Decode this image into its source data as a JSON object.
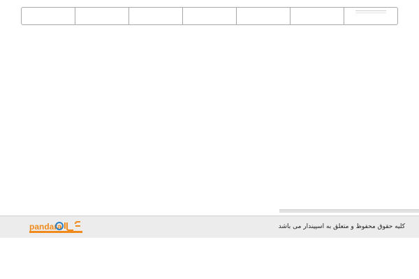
{
  "nav": {
    "items": [
      {
        "label": ""
      },
      {
        "label": ""
      },
      {
        "label": ""
      },
      {
        "label": ""
      },
      {
        "label": ""
      },
      {
        "label": ""
      },
      {
        "label": ""
      }
    ]
  },
  "footer": {
    "copyright": "کلیه حقوق محفوظ و متعلق به اسپیندار می باشد",
    "logo_text": "pandara",
    "logo_color": "#f08a1c"
  }
}
